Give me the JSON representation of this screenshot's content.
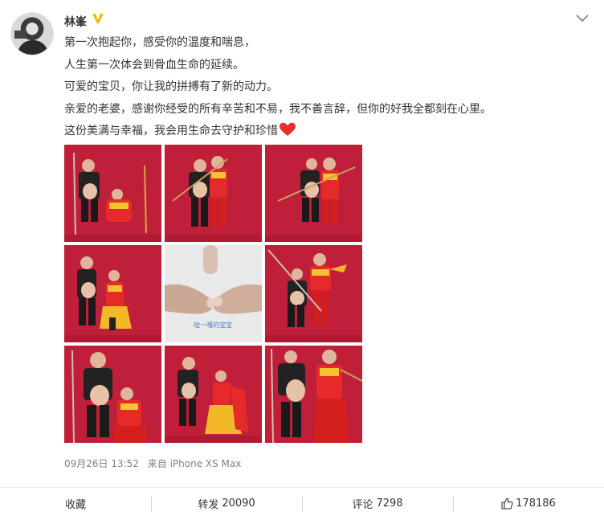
{
  "post": {
    "author": "林峯",
    "lines": [
      "第一次抱起你，感受你的温度和喘息，",
      "人生第一次体会到骨血生命的延续。",
      "可爱的宝贝，你让我的拼搏有了新的动力。",
      "亲爱的老婆，感谢你经受的所有辛苦和不易，我不善言辞，但你的好我全都刻在心里。",
      "这份美满与幸福，我会用生命去守护和珍惜"
    ],
    "timestamp": "09月26日 13:52",
    "source": "来自 iPhone XS Max",
    "photos_count": 9,
    "photo_caption_5": "哒一嘎的宝宝"
  },
  "actions": {
    "favorite": "收藏",
    "repost_label": "转发",
    "repost_count": "20090",
    "comment_label": "评论",
    "comment_count": "7298",
    "like_count": "178186"
  },
  "colors": {
    "verified": "#f7b500",
    "photo_background": "#c01f3a",
    "heart": "#e8302f",
    "muted_text": "#808080"
  },
  "icons": [
    "verified-icon",
    "chevron-down-icon",
    "heart-icon",
    "like-icon"
  ]
}
